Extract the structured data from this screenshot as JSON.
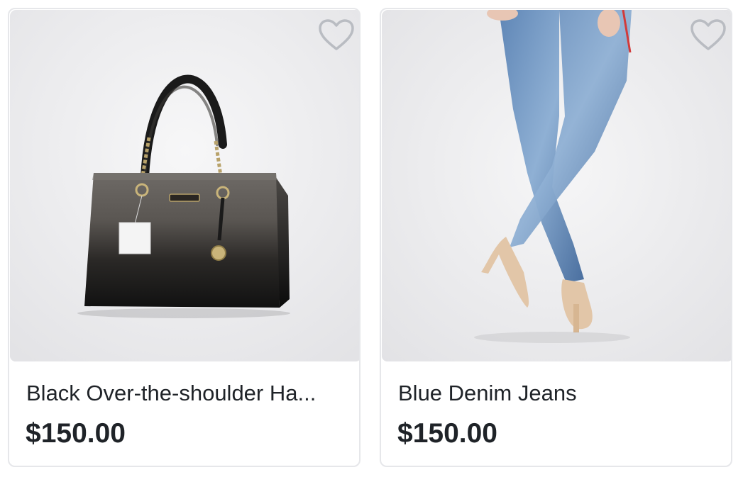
{
  "products": [
    {
      "title": "Black Over-the-shoulder Ha...",
      "price": "$150.00",
      "image": "black-handbag-photo",
      "favorite_icon": "heart-outline-icon"
    },
    {
      "title": "Blue Denim Jeans",
      "price": "$150.00",
      "image": "blue-denim-jeans-photo",
      "favorite_icon": "heart-outline-icon"
    }
  ],
  "colors": {
    "text": "#1f2328",
    "card_border": "#e6e7ea",
    "icon": "#b9bcc2"
  }
}
